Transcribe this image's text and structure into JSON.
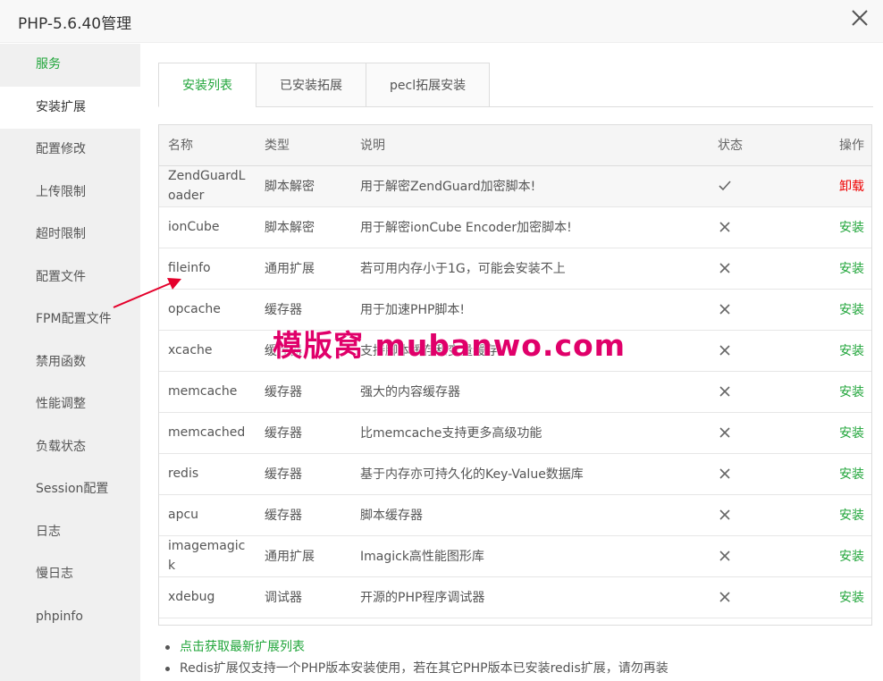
{
  "window": {
    "title": "PHP-5.6.40管理"
  },
  "sidebar": {
    "items": [
      {
        "label": "服务",
        "name": "sidebar-item-service"
      },
      {
        "label": "安装扩展",
        "name": "sidebar-item-install-extension"
      },
      {
        "label": "配置修改",
        "name": "sidebar-item-config-edit"
      },
      {
        "label": "上传限制",
        "name": "sidebar-item-upload-limit"
      },
      {
        "label": "超时限制",
        "name": "sidebar-item-timeout-limit"
      },
      {
        "label": "配置文件",
        "name": "sidebar-item-config-file"
      },
      {
        "label": "FPM配置文件",
        "name": "sidebar-item-fpm-config"
      },
      {
        "label": "禁用函数",
        "name": "sidebar-item-disabled-functions"
      },
      {
        "label": "性能调整",
        "name": "sidebar-item-performance"
      },
      {
        "label": "负载状态",
        "name": "sidebar-item-load-status"
      },
      {
        "label": "Session配置",
        "name": "sidebar-item-session"
      },
      {
        "label": "日志",
        "name": "sidebar-item-log"
      },
      {
        "label": "慢日志",
        "name": "sidebar-item-slow-log"
      },
      {
        "label": "phpinfo",
        "name": "sidebar-item-phpinfo"
      }
    ]
  },
  "tabs": [
    {
      "label": "安装列表"
    },
    {
      "label": "已安装拓展"
    },
    {
      "label": "pecl拓展安装"
    }
  ],
  "table": {
    "headers": {
      "name": "名称",
      "type": "类型",
      "desc": "说明",
      "status": "状态",
      "op": "操作"
    },
    "rows": [
      {
        "name": "ZendGuardLoader",
        "type": "脚本解密",
        "desc": "用于解密ZendGuard加密脚本!",
        "installed": true,
        "op": "卸载"
      },
      {
        "name": "ionCube",
        "type": "脚本解密",
        "desc": "用于解密ionCube Encoder加密脚本!",
        "installed": false,
        "op": "安装"
      },
      {
        "name": "fileinfo",
        "type": "通用扩展",
        "desc": "若可用内存小于1G，可能会安装不上",
        "installed": false,
        "op": "安装"
      },
      {
        "name": "opcache",
        "type": "缓存器",
        "desc": "用于加速PHP脚本!",
        "installed": false,
        "op": "安装"
      },
      {
        "name": "xcache",
        "type": "缓存器",
        "desc": "支持脚本缓存和变量缓存!",
        "installed": false,
        "op": "安装"
      },
      {
        "name": "memcache",
        "type": "缓存器",
        "desc": "强大的内容缓存器",
        "installed": false,
        "op": "安装"
      },
      {
        "name": "memcached",
        "type": "缓存器",
        "desc": "比memcache支持更多高级功能",
        "installed": false,
        "op": "安装"
      },
      {
        "name": "redis",
        "type": "缓存器",
        "desc": "基于内存亦可持久化的Key-Value数据库",
        "installed": false,
        "op": "安装"
      },
      {
        "name": "apcu",
        "type": "缓存器",
        "desc": "脚本缓存器",
        "installed": false,
        "op": "安装"
      },
      {
        "name": "imagemagick",
        "type": "通用扩展",
        "desc": "Imagick高性能图形库",
        "installed": false,
        "op": "安装"
      },
      {
        "name": "xdebug",
        "type": "调试器",
        "desc": "开源的PHP程序调试器",
        "installed": false,
        "op": "安装"
      }
    ]
  },
  "notes": [
    "点击获取最新扩展列表",
    "Redis扩展仅支持一个PHP版本安装使用，若在其它PHP版本已安装redis扩展，请勿再装"
  ],
  "watermark": "模版窝 mubanwo.com",
  "colors": {
    "accent": "#20a53a",
    "danger": "#e00000",
    "watermark": "#e0006a"
  }
}
